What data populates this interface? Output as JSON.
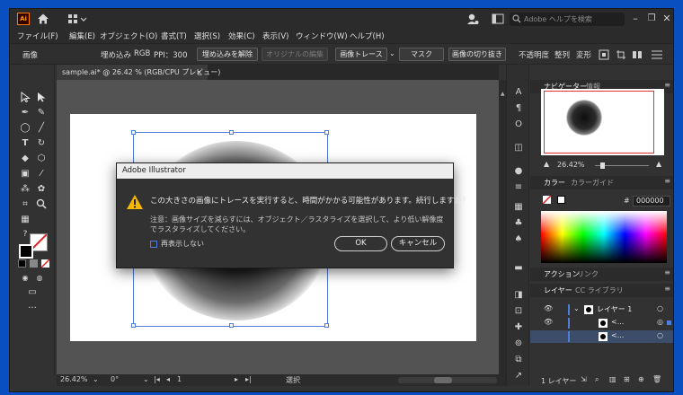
{
  "app": {
    "logo_text": "Ai"
  },
  "title_bar": {
    "search_placeholder": "Adobe ヘルプを検索"
  },
  "menu": [
    "ファイル(F)",
    "編集(E)",
    "オブジェクト(O)",
    "書式(T)",
    "選択(S)",
    "効果(C)",
    "表示(V)",
    "ウィンドウ(W)",
    "ヘルプ(H)"
  ],
  "control_bar": {
    "type_label": "画像",
    "embed_label": "埋め込み",
    "color_mode": "RGB",
    "ppi_label": "PPI：300",
    "unembed_button": "埋め込みを解除",
    "edit_original_button": "オリジナルの編集",
    "image_trace_button": "画像トレース",
    "mask_button": "マスク",
    "crop_button": "画像の切り抜き",
    "opacity_label": "不透明度",
    "align_label": "整列",
    "transform_label": "変形"
  },
  "document_tab": {
    "title": "sample.ai* @ 26.42 % (RGB/CPU プレビュー)",
    "close": "×"
  },
  "tools": {
    "fill_stroke_swap": "?"
  },
  "status_bar": {
    "zoom": "26.42%",
    "rotation": "0°",
    "artboard_number": "1",
    "mode": "選択"
  },
  "panels": {
    "navigator_tab": "ナビゲーター",
    "info_tab": "情報",
    "nav_zoom": "26.42%",
    "color_tab": "カラー",
    "color_guide_tab": "カラーガイド",
    "hex_prefix": "#",
    "hex_value": "000000",
    "actions_tab": "アクション",
    "links_tab": "リンク",
    "layers_tab": "レイヤー",
    "libraries_tab": "CC ライブラリ",
    "layers": [
      {
        "name": "レイヤー 1"
      },
      {
        "name": "<..."
      },
      {
        "name": "<..."
      }
    ],
    "layer_count": "1 レイヤー"
  },
  "dialog": {
    "title": "Adobe Illustrator",
    "message": "この大きさの画像にトレースを実行すると、時間がかかる可能性があります。続行しますか？",
    "note_line1": "注意：画像サイズを減らすには、オブジェクト／ラスタライズを選択して、より低い解像度",
    "note_line2": "でラスタライズしてください。",
    "checkbox_label": "再表示しない",
    "ok_button": "OK",
    "cancel_button": "キャンセル"
  },
  "colors": {
    "accent": "#4f7dda",
    "warning": "#f5b800",
    "app_bg": "#323232",
    "canvas_bg": "#535353"
  }
}
